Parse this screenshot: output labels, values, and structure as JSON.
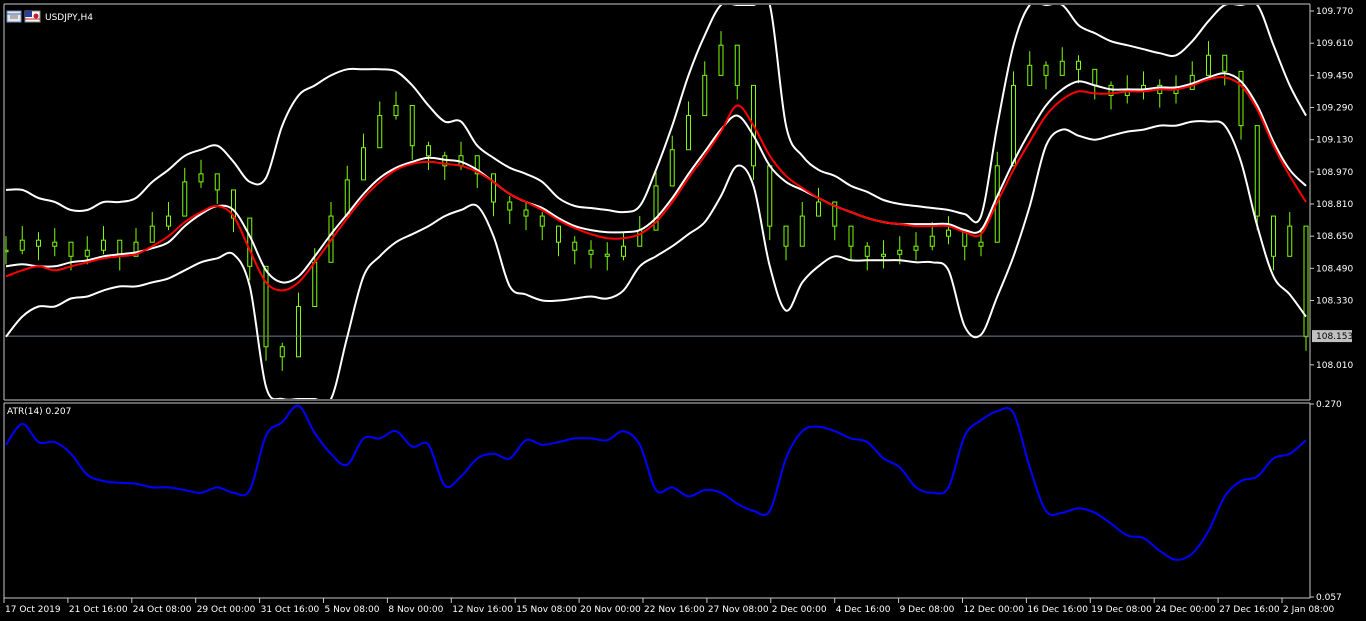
{
  "window": {
    "symbol_title": "USDJPY,H4"
  },
  "colors": {
    "background": "#000000",
    "frame": "#c8c8c8",
    "candles": "#7CFC00",
    "bands": "#ffffff",
    "ma": "#ff0000",
    "atr": "#0000ff",
    "bid_line": "#708090",
    "price_tag_bg": "#c0c0c0"
  },
  "icons": [
    "chart-window-icon",
    "symbol-flag-icon"
  ],
  "chart_data": [
    {
      "type": "line",
      "panel": "main",
      "symbol": "USDJPY",
      "timeframe": "H4",
      "y_ticks": [
        "109.770",
        "109.610",
        "109.450",
        "109.290",
        "109.130",
        "108.970",
        "108.810",
        "108.650",
        "108.490",
        "108.330",
        "108.010"
      ],
      "ylim": [
        107.84,
        109.8
      ],
      "current_price": "108.153",
      "x_ticks": [
        "17 Oct 2019",
        "21 Oct 16:00",
        "24 Oct 08:00",
        "29 Oct 00:00",
        "31 Oct 16:00",
        "5 Nov 08:00",
        "8 Nov 00:00",
        "12 Nov 16:00",
        "15 Nov 08:00",
        "20 Nov 00:00",
        "22 Nov 16:00",
        "27 Nov 08:00",
        "2 Dec 00:00",
        "4 Dec 16:00",
        "9 Dec 08:00",
        "12 Dec 00:00",
        "16 Dec 16:00",
        "19 Dec 08:00",
        "24 Dec 00:00",
        "27 Dec 16:00",
        "2 Jan 08:00"
      ],
      "x_points": 81,
      "series": [
        {
          "values": [
            108.58,
            108.63,
            108.6,
            108.62,
            108.55,
            108.58,
            108.63,
            108.55,
            108.62,
            108.7,
            108.75,
            108.92,
            108.96,
            108.88,
            108.74,
            108.5,
            108.1,
            108.05,
            108.3,
            108.52,
            108.75,
            108.93,
            109.09,
            109.25,
            109.3,
            109.1,
            109.05,
            109.0,
            109.05,
            108.96,
            108.82,
            108.78,
            108.75,
            108.7,
            108.62,
            108.58,
            108.56,
            108.55,
            108.6,
            108.68,
            108.9,
            109.08,
            109.25,
            109.45,
            109.6,
            109.4,
            109.0,
            108.7,
            108.6,
            108.75,
            108.82,
            108.7,
            108.6,
            108.55,
            108.56,
            108.58,
            108.6,
            108.65,
            108.68,
            108.6,
            108.62,
            109.0,
            109.4,
            109.5,
            109.45,
            109.52,
            109.48,
            109.4,
            109.35,
            109.38,
            109.4,
            109.36,
            109.38,
            109.45,
            109.55,
            109.47,
            109.2,
            108.75,
            108.55,
            108.7,
            108.15
          ]
        },
        {
          "values": [
            108.88,
            108.88,
            108.84,
            108.82,
            108.78,
            108.78,
            108.82,
            108.82,
            108.84,
            108.92,
            108.98,
            109.05,
            109.08,
            109.1,
            109.02,
            108.92,
            108.94,
            109.2,
            109.35,
            109.4,
            109.45,
            109.48,
            109.48,
            109.48,
            109.47,
            109.4,
            109.3,
            109.22,
            109.22,
            109.1,
            109.04,
            108.99,
            108.96,
            108.92,
            108.84,
            108.8,
            108.79,
            108.78,
            108.77,
            108.8,
            108.98,
            109.2,
            109.45,
            109.65,
            109.8,
            109.8,
            109.8,
            109.8,
            109.2,
            109.05,
            108.98,
            108.95,
            108.9,
            108.87,
            108.83,
            108.81,
            108.8,
            108.79,
            108.78,
            108.76,
            108.75,
            109.2,
            109.6,
            109.8,
            109.8,
            109.8,
            109.7,
            109.66,
            109.62,
            109.6,
            109.58,
            109.56,
            109.55,
            109.62,
            109.72,
            109.8,
            109.8,
            109.8,
            109.6,
            109.4,
            109.25
          ]
        },
        {
          "values": [
            108.5,
            108.51,
            108.5,
            108.5,
            108.52,
            108.53,
            108.55,
            108.56,
            108.57,
            108.59,
            108.62,
            108.7,
            108.76,
            108.8,
            108.78,
            108.65,
            108.48,
            108.42,
            108.45,
            108.55,
            108.66,
            108.76,
            108.86,
            108.94,
            108.99,
            109.02,
            109.04,
            109.03,
            109.02,
            108.98,
            108.92,
            108.86,
            108.82,
            108.79,
            108.74,
            108.7,
            108.68,
            108.67,
            108.67,
            108.68,
            108.74,
            108.84,
            108.96,
            109.07,
            109.18,
            109.25,
            109.15,
            109.0,
            108.92,
            108.88,
            108.84,
            108.8,
            108.77,
            108.74,
            108.72,
            108.71,
            108.71,
            108.71,
            108.71,
            108.68,
            108.68,
            108.85,
            109.02,
            109.17,
            109.3,
            109.38,
            109.42,
            109.4,
            109.38,
            109.38,
            109.38,
            109.39,
            109.39,
            109.41,
            109.44,
            109.46,
            109.42,
            109.3,
            109.12,
            108.98,
            108.9
          ]
        },
        {
          "values": [
            108.45,
            108.48,
            108.5,
            108.48,
            108.5,
            108.52,
            108.54,
            108.55,
            108.56,
            108.6,
            108.65,
            108.72,
            108.77,
            108.8,
            108.75,
            108.58,
            108.42,
            108.38,
            108.42,
            108.52,
            108.63,
            108.74,
            108.84,
            108.92,
            108.98,
            109.01,
            109.02,
            109.01,
            109.0,
            108.97,
            108.92,
            108.86,
            108.82,
            108.78,
            108.73,
            108.69,
            108.66,
            108.64,
            108.64,
            108.66,
            108.72,
            108.82,
            108.94,
            109.05,
            109.17,
            109.3,
            109.2,
            109.05,
            108.95,
            108.89,
            108.84,
            108.8,
            108.77,
            108.74,
            108.72,
            108.71,
            108.7,
            108.7,
            108.7,
            108.67,
            108.66,
            108.82,
            108.98,
            109.12,
            109.25,
            109.33,
            109.37,
            109.36,
            109.36,
            109.37,
            109.37,
            109.38,
            109.38,
            109.4,
            109.43,
            109.44,
            109.4,
            109.28,
            109.1,
            108.95,
            108.82
          ]
        },
        {
          "values": [
            108.15,
            108.25,
            108.3,
            108.3,
            108.34,
            108.35,
            108.38,
            108.4,
            108.4,
            108.42,
            108.44,
            108.48,
            108.52,
            108.54,
            108.56,
            108.4,
            107.9,
            107.84,
            107.84,
            107.84,
            107.84,
            108.15,
            108.45,
            108.55,
            108.62,
            108.66,
            108.7,
            108.75,
            108.78,
            108.8,
            108.65,
            108.4,
            108.36,
            108.33,
            108.33,
            108.34,
            108.35,
            108.34,
            108.38,
            108.5,
            108.55,
            108.6,
            108.66,
            108.72,
            108.85,
            109.0,
            108.9,
            108.5,
            108.28,
            108.42,
            108.5,
            108.55,
            108.53,
            108.53,
            108.53,
            108.53,
            108.52,
            108.52,
            108.48,
            108.2,
            108.16,
            108.35,
            108.55,
            108.8,
            109.1,
            109.18,
            109.15,
            109.13,
            109.15,
            109.17,
            109.18,
            109.2,
            109.2,
            109.22,
            109.22,
            109.2,
            109.02,
            108.7,
            108.45,
            108.36,
            108.25
          ]
        }
      ]
    },
    {
      "type": "line",
      "panel": "indicator",
      "title": "ATR(14) 0.207",
      "y_ticks": [
        "0.270",
        "0.057"
      ],
      "ylim": [
        0.057,
        0.27
      ],
      "x_points": 81,
      "series": [
        {
          "values": [
            0.225,
            0.248,
            0.228,
            0.228,
            0.215,
            0.192,
            0.185,
            0.183,
            0.182,
            0.178,
            0.178,
            0.175,
            0.172,
            0.178,
            0.172,
            0.175,
            0.235,
            0.25,
            0.268,
            0.238,
            0.215,
            0.203,
            0.232,
            0.232,
            0.24,
            0.223,
            0.225,
            0.18,
            0.19,
            0.21,
            0.215,
            0.21,
            0.23,
            0.225,
            0.228,
            0.232,
            0.232,
            0.23,
            0.24,
            0.225,
            0.175,
            0.178,
            0.168,
            0.175,
            0.172,
            0.16,
            0.152,
            0.152,
            0.21,
            0.24,
            0.245,
            0.24,
            0.232,
            0.228,
            0.21,
            0.2,
            0.178,
            0.172,
            0.178,
            0.235,
            0.252,
            0.262,
            0.26,
            0.2,
            0.152,
            0.15,
            0.155,
            0.15,
            0.138,
            0.125,
            0.122,
            0.108,
            0.098,
            0.105,
            0.13,
            0.168,
            0.185,
            0.19,
            0.21,
            0.215,
            0.23
          ]
        }
      ]
    }
  ]
}
